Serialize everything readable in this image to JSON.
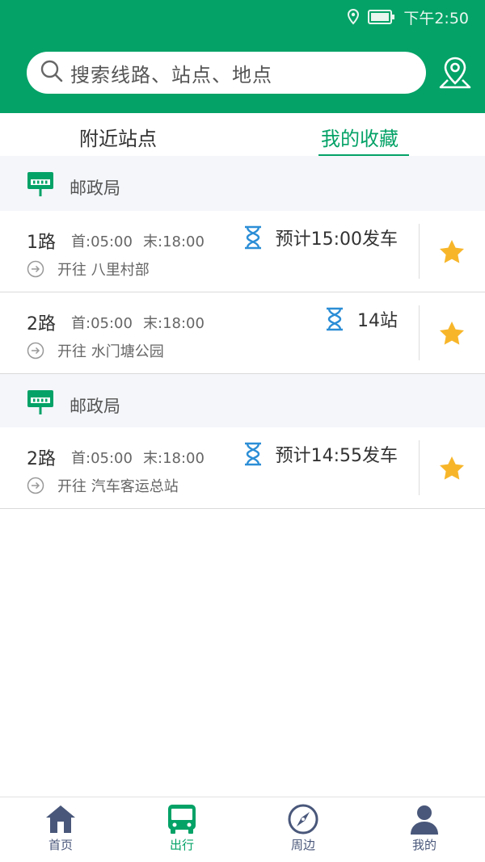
{
  "status_bar": {
    "time": "下午2:50"
  },
  "search": {
    "placeholder": "搜索线路、站点、地点"
  },
  "tabs": [
    {
      "label": "附近站点",
      "active": false
    },
    {
      "label": "我的收藏",
      "active": true
    }
  ],
  "groups": [
    {
      "station": "邮政局",
      "routes": [
        {
          "name": "1路",
          "first": "首:05:00",
          "last": "末:18:00",
          "status": "预计15:00发车",
          "destination": "开往 八里村部",
          "favorite": true
        },
        {
          "name": "2路",
          "first": "首:05:00",
          "last": "末:18:00",
          "status": "14站",
          "destination": "开往 水门塘公园",
          "favorite": true
        }
      ]
    },
    {
      "station": "邮政局",
      "routes": [
        {
          "name": "2路",
          "first": "首:05:00",
          "last": "末:18:00",
          "status": "预计14:55发车",
          "destination": "开往 汽车客运总站",
          "favorite": true
        }
      ]
    }
  ],
  "bottom_nav": [
    {
      "label": "首页",
      "icon": "home-icon",
      "active": false
    },
    {
      "label": "出行",
      "icon": "bus-icon",
      "active": true
    },
    {
      "label": "周边",
      "icon": "compass-icon",
      "active": false
    },
    {
      "label": "我的",
      "icon": "user-icon",
      "active": false
    }
  ],
  "colors": {
    "brand": "#04a267",
    "star": "#f7b62a",
    "hourglass": "#2c8ed6",
    "nav_inactive": "#49577a"
  }
}
